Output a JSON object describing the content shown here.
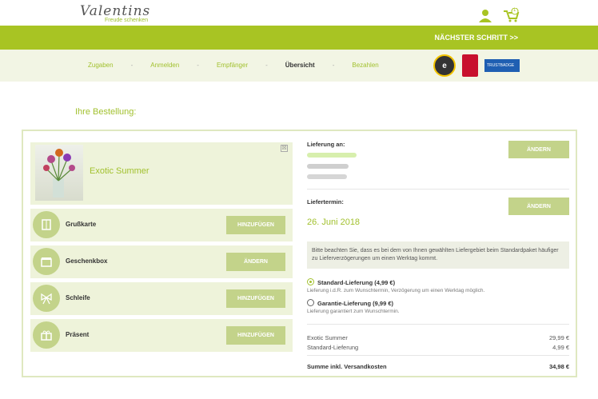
{
  "brand": {
    "name": "Valentins",
    "tagline": "Freude schenken"
  },
  "header": {
    "cart_count": "1",
    "next_step": "NÄCHSTER SCHRITT >>"
  },
  "steps": [
    {
      "label": "Zugaben"
    },
    {
      "label": "Anmelden"
    },
    {
      "label": "Empfänger"
    },
    {
      "label": "Übersicht"
    },
    {
      "label": "Bezahlen"
    }
  ],
  "step_separator": "-",
  "trust": {
    "trustedshops": "e",
    "blue_badge": "TRUSTBADGE"
  },
  "order": {
    "heading": "Ihre Bestellung:",
    "product": {
      "name": "Exotic Summer",
      "remove": "☒"
    },
    "extras": [
      {
        "label": "Grußkarte",
        "button": "HINZUFÜGEN",
        "icon": "card-icon"
      },
      {
        "label": "Geschenkbox",
        "button": "ÄNDERN",
        "icon": "giftbox-icon"
      },
      {
        "label": "Schleife",
        "button": "HINZUFÜGEN",
        "icon": "ribbon-icon"
      },
      {
        "label": "Präsent",
        "button": "HINZUFÜGEN",
        "icon": "present-icon"
      }
    ]
  },
  "delivery": {
    "address_label": "Lieferung an:",
    "change1": "ÄNDERN",
    "date_label": "Liefertermin:",
    "date": "26. Juni 2018",
    "change2": "ÄNDERN",
    "notice": "Bitte beachten Sie, dass es bei dem von Ihnen gewählten Liefergebiet beim Standardpaket häufiger zu Lieferverzögerungen um einen Werktag kommt.",
    "options": [
      {
        "label": "Standard-Lieferung (4,99 €)",
        "sub": "Lieferung i.d.R. zum Wunschtermin, Verzögerung um einen Werktag möglich.",
        "selected": true
      },
      {
        "label": "Garantie-Lieferung (9,99 €)",
        "sub": "Lieferung garantiert zum Wunschtermin.",
        "selected": false
      }
    ]
  },
  "summary": {
    "rows": [
      {
        "label": "Exotic Summer",
        "value": "29,99 €"
      },
      {
        "label": "Standard-Lieferung",
        "value": "4,99 €"
      }
    ],
    "total_label": "Summe inkl. Versandkosten",
    "total_value": "34,98 €"
  },
  "colors": {
    "accent": "#a8c423",
    "soft": "#eef3da",
    "button": "#c3d38a"
  }
}
